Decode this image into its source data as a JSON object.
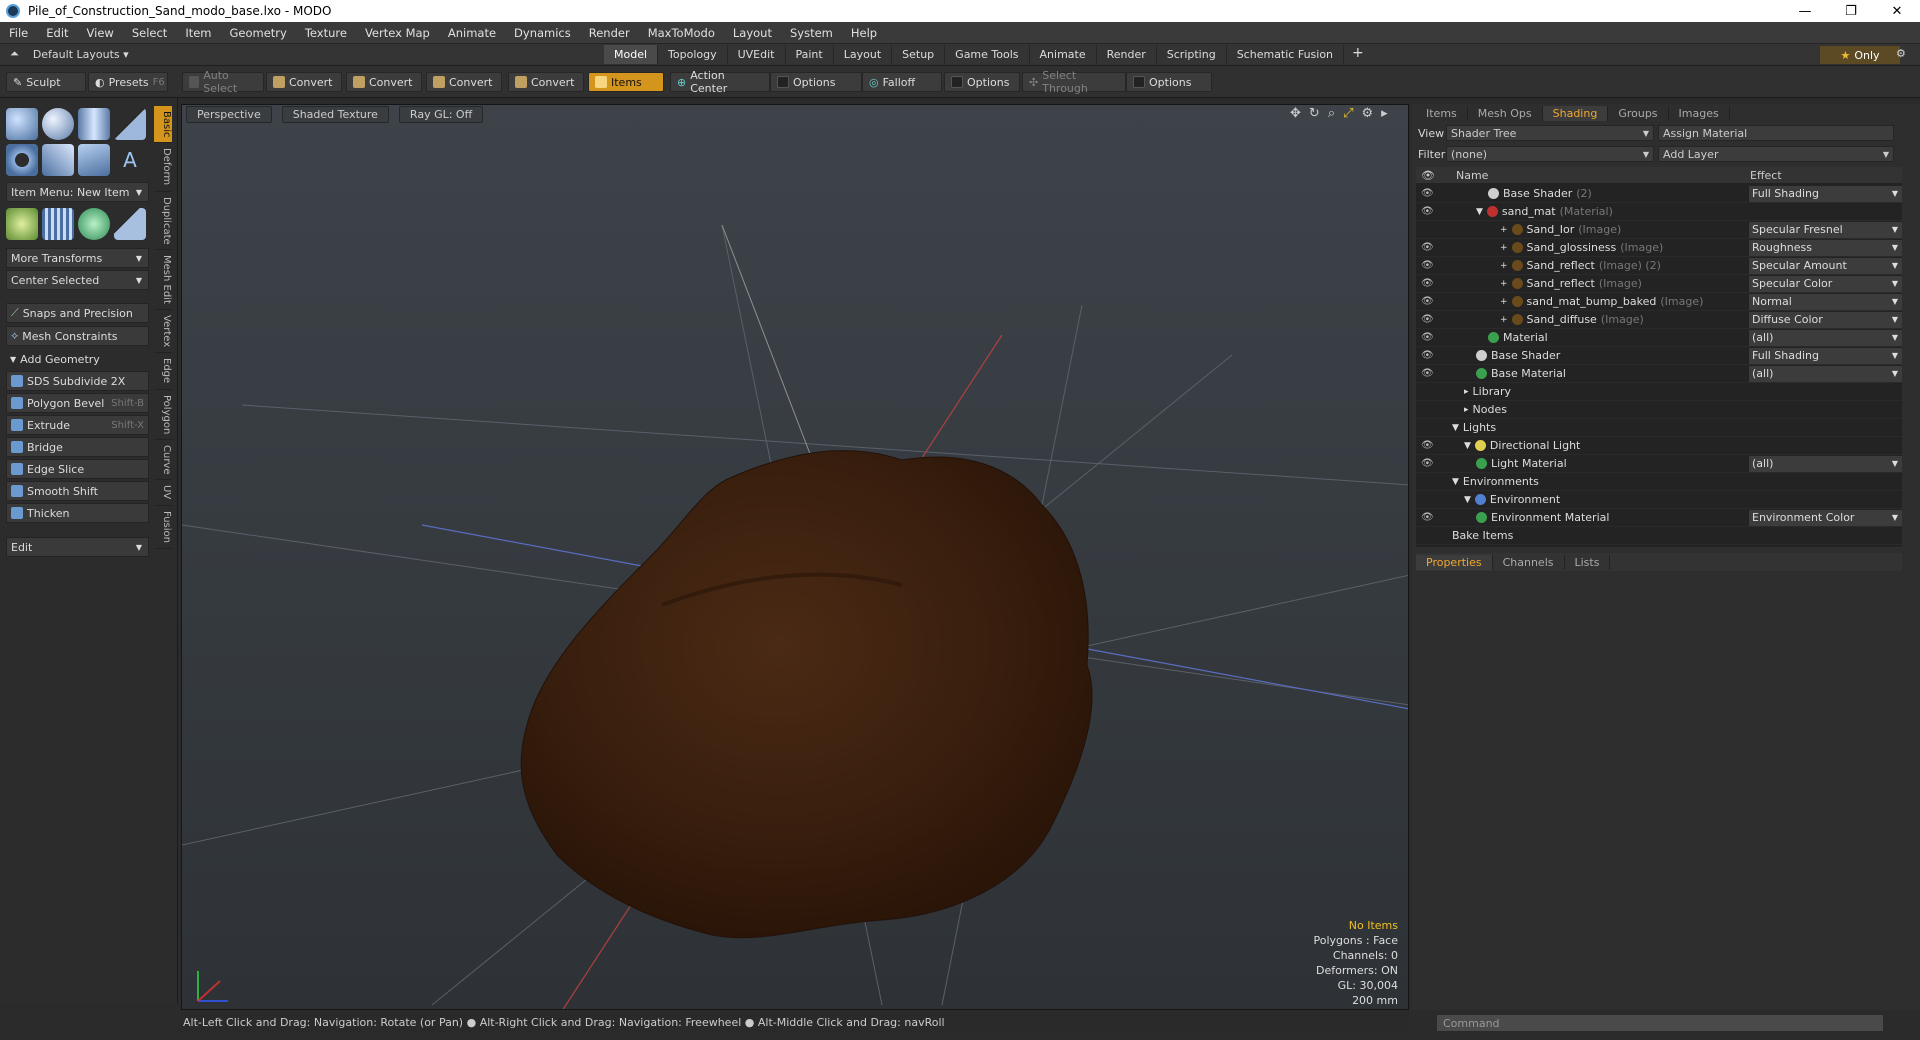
{
  "window": {
    "title": "Pile_of_Construction_Sand_modo_base.lxo - MODO",
    "min": "—",
    "max": "❐",
    "close": "✕"
  },
  "menu": [
    "File",
    "Edit",
    "View",
    "Select",
    "Item",
    "Geometry",
    "Texture",
    "Vertex Map",
    "Animate",
    "Dynamics",
    "Render",
    "MaxToModo",
    "Layout",
    "System",
    "Help"
  ],
  "layoutbar": {
    "layouts_label": "Default Layouts",
    "tabs": [
      "Model",
      "Topology",
      "UVEdit",
      "Paint",
      "Layout",
      "Setup",
      "Game Tools",
      "Animate",
      "Render",
      "Scripting",
      "Schematic Fusion"
    ],
    "active_tab": "Model",
    "plus": "+",
    "only": "Only"
  },
  "toolbar": {
    "sculpt": "Sculpt",
    "presets": "Presets",
    "presets_key": "F6",
    "auto_select": "Auto Select",
    "convert": "Convert",
    "items": "Items",
    "action_center": "Action Center",
    "options": "Options",
    "falloff": "Falloff",
    "select_through": "Select Through"
  },
  "leftpanel": {
    "item_menu": "Item Menu: New Item",
    "more_transforms": "More Transforms",
    "center_selected": "Center Selected",
    "snaps": "Snaps and Precision",
    "mesh_constraints": "Mesh Constraints",
    "add_geometry": "Add Geometry",
    "tools": [
      {
        "label": "SDS Subdivide 2X",
        "key": ""
      },
      {
        "label": "Polygon Bevel",
        "key": "Shift-B"
      },
      {
        "label": "Extrude",
        "key": "Shift-X"
      },
      {
        "label": "Bridge",
        "key": ""
      },
      {
        "label": "Edge Slice",
        "key": ""
      },
      {
        "label": "Smooth Shift",
        "key": ""
      },
      {
        "label": "Thicken",
        "key": ""
      }
    ],
    "edit": "Edit",
    "vtabs": [
      "Basic",
      "Deform",
      "Duplicate",
      "Mesh Edit",
      "Vertex",
      "Edge",
      "Polygon",
      "Curve",
      "UV",
      "Fusion"
    ]
  },
  "viewport": {
    "perspective": "Perspective",
    "shading": "Shaded Texture",
    "raygl": "Ray GL: Off",
    "stats": {
      "items": "No Items",
      "polygons": "Polygons : Face",
      "channels": "Channels: 0",
      "deformers": "Deformers: ON",
      "gl": "GL: 30,004",
      "scale": "200 mm"
    }
  },
  "status": "Alt-Left Click and Drag: Navigation: Rotate (or Pan) ● Alt-Right Click and Drag: Navigation: Freewheel ● Alt-Middle Click and Drag: navRoll",
  "rightpanel": {
    "tabs": [
      "Items",
      "Mesh Ops",
      "Shading",
      "Groups",
      "Images"
    ],
    "active_tab": "Shading",
    "view_label": "View",
    "view_value": "Shader Tree",
    "assign": "Assign Material",
    "filter_label": "Filter",
    "filter_value": "(none)",
    "add_layer": "Add Layer",
    "col_name": "Name",
    "col_effect": "Effect",
    "tree": [
      {
        "indent": 4,
        "exp": "",
        "name": "Base Shader",
        "type": "(2)",
        "effect": "Full Shading",
        "ball": "#cfcfcf",
        "eye": true
      },
      {
        "indent": 3,
        "exp": "▼",
        "name": "sand_mat",
        "type": "(Material)",
        "effect": "",
        "ball": "#c03030",
        "eye": true
      },
      {
        "indent": 5,
        "exp": "+",
        "name": "Sand_Ior",
        "type": "(Image)",
        "effect": "Specular Fresnel",
        "ball": "#6a4a1a",
        "eye": false
      },
      {
        "indent": 5,
        "exp": "+",
        "name": "Sand_glossiness",
        "type": "(Image)",
        "effect": "Roughness",
        "ball": "#6a4a1a",
        "eye": true
      },
      {
        "indent": 5,
        "exp": "+",
        "name": "Sand_reflect",
        "type": "(Image) (2)",
        "effect": "Specular Amount",
        "ball": "#6a4a1a",
        "eye": true
      },
      {
        "indent": 5,
        "exp": "+",
        "name": "Sand_reflect",
        "type": "(Image)",
        "effect": "Specular Color",
        "ball": "#6a4a1a",
        "eye": true
      },
      {
        "indent": 5,
        "exp": "+",
        "name": "sand_mat_bump_baked",
        "type": "(Image)",
        "effect": "Normal",
        "ball": "#6a4a1a",
        "eye": true
      },
      {
        "indent": 5,
        "exp": "+",
        "name": "Sand_diffuse",
        "type": "(Image)",
        "effect": "Diffuse Color",
        "ball": "#6a4a1a",
        "eye": true
      },
      {
        "indent": 4,
        "exp": "",
        "name": "Material",
        "type": "",
        "effect": "(all)",
        "ball": "#3aa050",
        "eye": true
      },
      {
        "indent": 3,
        "exp": "",
        "name": "Base Shader",
        "type": "",
        "effect": "Full Shading",
        "ball": "#cfcfcf",
        "eye": true
      },
      {
        "indent": 3,
        "exp": "",
        "name": "Base Material",
        "type": "",
        "effect": "(all)",
        "ball": "#3aa050",
        "eye": true
      },
      {
        "indent": 2,
        "exp": "▸",
        "name": "Library",
        "type": "",
        "effect": "",
        "ball": "",
        "eye": false
      },
      {
        "indent": 2,
        "exp": "▸",
        "name": "Nodes",
        "type": "",
        "effect": "",
        "ball": "",
        "eye": false
      },
      {
        "indent": 1,
        "exp": "▼",
        "name": "Lights",
        "type": "",
        "effect": "",
        "ball": "",
        "eye": false
      },
      {
        "indent": 2,
        "exp": "▼",
        "name": "Directional Light",
        "type": "",
        "effect": "",
        "ball": "#e0d050",
        "eye": true
      },
      {
        "indent": 3,
        "exp": "",
        "name": "Light Material",
        "type": "",
        "effect": "(all)",
        "ball": "#3aa050",
        "eye": true
      },
      {
        "indent": 1,
        "exp": "▼",
        "name": "Environments",
        "type": "",
        "effect": "",
        "ball": "",
        "eye": false
      },
      {
        "indent": 2,
        "exp": "▼",
        "name": "Environment",
        "type": "",
        "effect": "",
        "ball": "#5080d0",
        "eye": false
      },
      {
        "indent": 3,
        "exp": "",
        "name": "Environment Material",
        "type": "",
        "effect": "Environment Color",
        "ball": "#3aa050",
        "eye": true
      },
      {
        "indent": 1,
        "exp": "",
        "name": "Bake Items",
        "type": "",
        "effect": "",
        "ball": "",
        "eye": false
      }
    ],
    "ptabs": [
      "Properties",
      "Channels",
      "Lists"
    ],
    "command_placeholder": "Command"
  }
}
